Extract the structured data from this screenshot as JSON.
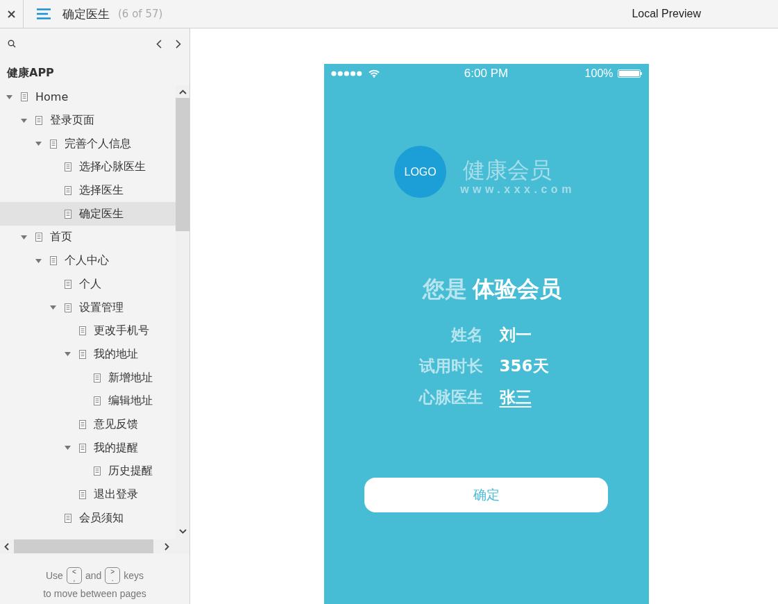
{
  "header": {
    "title": "确定医生",
    "counter": "(6 of 57)",
    "preview_label": "Local Preview"
  },
  "sidebar": {
    "project": "健康APP",
    "tree": [
      {
        "label": "Home",
        "expanded": true,
        "selected": false,
        "children": [
          {
            "label": "登录页面",
            "expanded": true,
            "selected": false,
            "children": [
              {
                "label": "完善个人信息",
                "expanded": true,
                "selected": false,
                "children": [
                  {
                    "label": "选择心脉医生",
                    "selected": false
                  },
                  {
                    "label": "选择医生",
                    "selected": false
                  },
                  {
                    "label": "确定医生",
                    "selected": true
                  }
                ]
              }
            ]
          },
          {
            "label": "首页",
            "expanded": true,
            "selected": false,
            "children": [
              {
                "label": "个人中心",
                "expanded": true,
                "selected": false,
                "children": [
                  {
                    "label": "个人",
                    "selected": false
                  },
                  {
                    "label": "设置管理",
                    "expanded": true,
                    "selected": false,
                    "children": [
                      {
                        "label": "更改手机号",
                        "selected": false
                      },
                      {
                        "label": "我的地址",
                        "expanded": true,
                        "selected": false,
                        "children": [
                          {
                            "label": "新增地址",
                            "selected": false
                          },
                          {
                            "label": "编辑地址",
                            "selected": false
                          }
                        ]
                      },
                      {
                        "label": "意见反馈",
                        "selected": false
                      },
                      {
                        "label": "我的提醒",
                        "expanded": true,
                        "selected": false,
                        "children": [
                          {
                            "label": "历史提醒",
                            "selected": false
                          }
                        ]
                      },
                      {
                        "label": "退出登录",
                        "selected": false
                      }
                    ]
                  },
                  {
                    "label": "会员须知",
                    "selected": false
                  }
                ]
              }
            ]
          }
        ]
      }
    ],
    "hint": {
      "use": "Use",
      "prev_key": {
        "top": "<",
        "bottom": ","
      },
      "and": "and",
      "next_key": {
        "top": ">",
        "bottom": "."
      },
      "keys": "keys",
      "line2": "to move between pages"
    }
  },
  "phone": {
    "status_bar": {
      "time": "6:00 PM",
      "battery": "100%"
    },
    "logo": {
      "badge": "LOGO",
      "name": "健康会员",
      "url": "www.xxx.com"
    },
    "heading": {
      "prefix": "您是",
      "level": "体验会员"
    },
    "info": [
      {
        "label": "姓名",
        "value": "刘一",
        "kind": "text"
      },
      {
        "label": "试用时长",
        "value": "356天",
        "kind": "text"
      },
      {
        "label": "心脉医生",
        "value": "张三",
        "kind": "link"
      }
    ],
    "confirm_button": "确定"
  }
}
